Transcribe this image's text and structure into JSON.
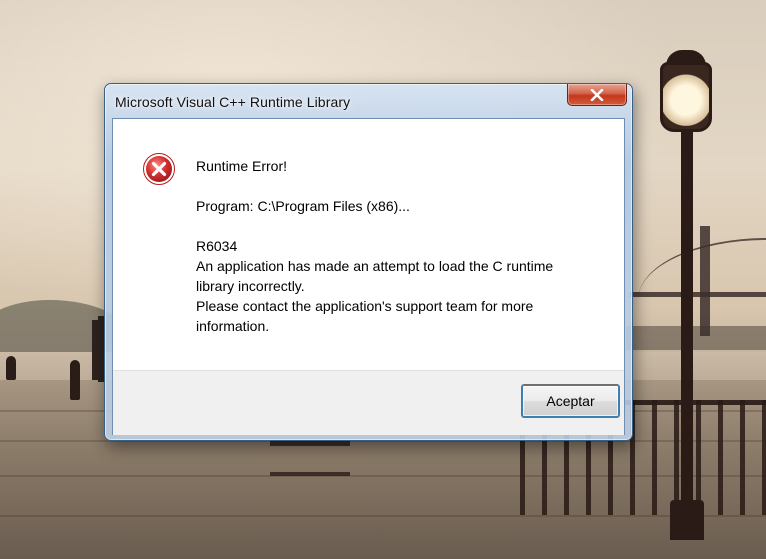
{
  "window": {
    "title": "Microsoft Visual C++ Runtime Library",
    "close_icon": "close-icon"
  },
  "message": {
    "icon": "error-icon",
    "heading": "Runtime Error!",
    "program": "Program: C:\\Program Files (x86)...",
    "code": "R6034",
    "line1": "An application has made an attempt to load the C runtime",
    "line2": "library incorrectly.",
    "line3": "Please contact the application's support team for more",
    "line4": "information."
  },
  "buttons": {
    "ok_label": "Aceptar"
  },
  "colors": {
    "error_red": "#c62828",
    "close_button_red": "#c2381d",
    "frame_blue": "#b0c8e4"
  }
}
